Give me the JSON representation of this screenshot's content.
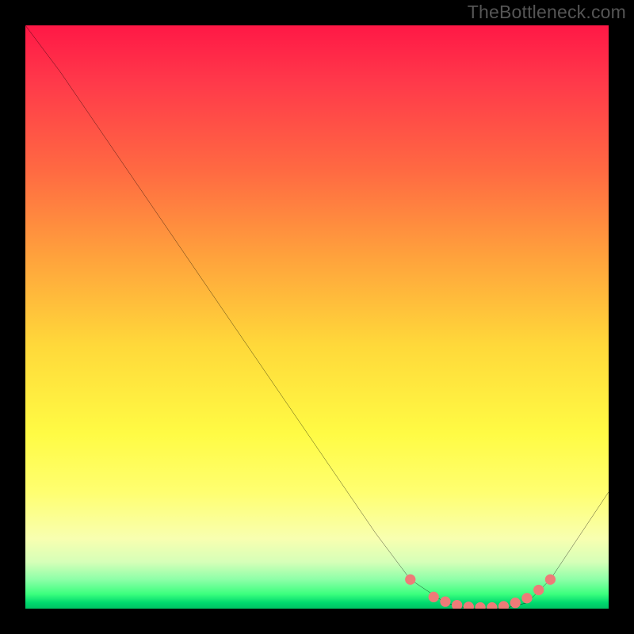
{
  "watermark": "TheBottleneck.com",
  "chart_data": {
    "type": "line",
    "title": "",
    "xlabel": "",
    "ylabel": "",
    "xlim": [
      0,
      100
    ],
    "ylim": [
      0,
      100
    ],
    "x": [
      0,
      6,
      60,
      66,
      72,
      76,
      82,
      86,
      90,
      100
    ],
    "y": [
      100,
      92,
      13,
      5,
      1,
      0,
      0,
      1,
      5,
      20
    ],
    "markers": {
      "x": [
        66,
        70,
        72,
        74,
        76,
        78,
        80,
        82,
        84,
        86,
        88,
        90
      ],
      "y": [
        5,
        2,
        1.2,
        0.6,
        0.3,
        0.2,
        0.2,
        0.4,
        1.0,
        1.8,
        3.2,
        5.0
      ]
    },
    "gradient_stops": [
      {
        "pct": 0,
        "color": "#ff1846"
      },
      {
        "pct": 10,
        "color": "#ff3a4a"
      },
      {
        "pct": 25,
        "color": "#ff6a42"
      },
      {
        "pct": 40,
        "color": "#ffa33c"
      },
      {
        "pct": 55,
        "color": "#ffd93a"
      },
      {
        "pct": 70,
        "color": "#fffb44"
      },
      {
        "pct": 80,
        "color": "#ffff70"
      },
      {
        "pct": 88,
        "color": "#f8ffb0"
      },
      {
        "pct": 92,
        "color": "#d6ffb8"
      },
      {
        "pct": 95,
        "color": "#8dffa8"
      },
      {
        "pct": 97.5,
        "color": "#3cff7e"
      },
      {
        "pct": 99,
        "color": "#00d96e"
      },
      {
        "pct": 100,
        "color": "#00c264"
      }
    ],
    "curve_color": "#000000",
    "marker_color": "#ee7b78"
  }
}
